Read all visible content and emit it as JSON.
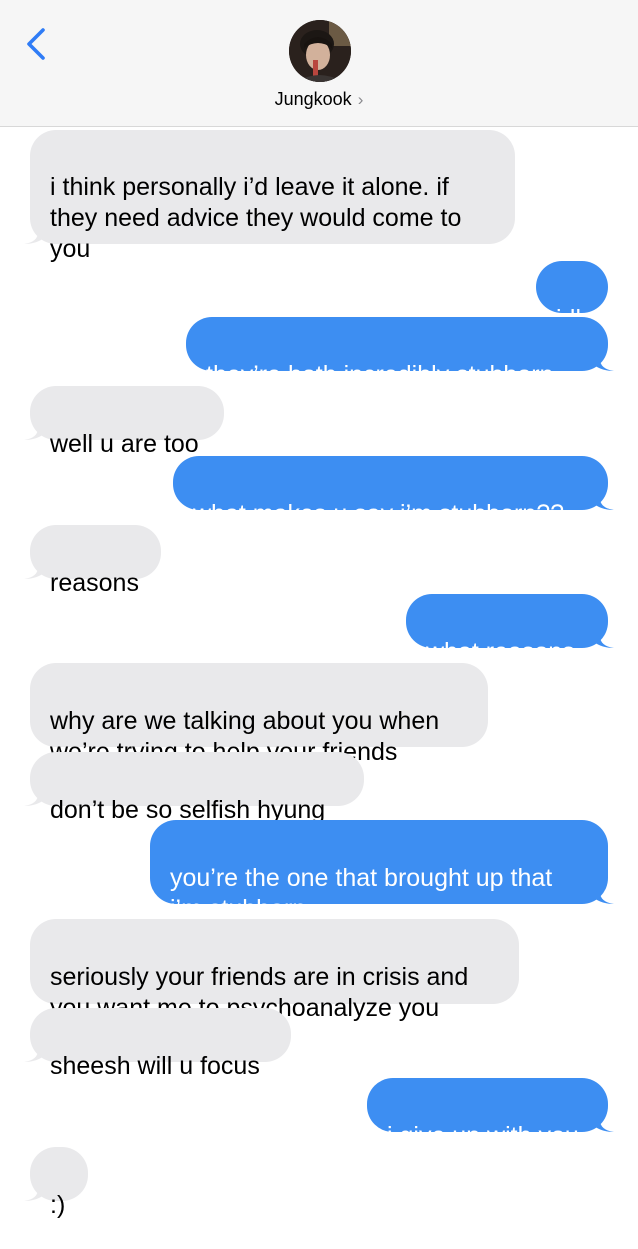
{
  "header": {
    "contact_name": "Jungkook",
    "chevron": "›",
    "icons": {
      "back": "chevron-left-icon",
      "avatar": "contact-avatar"
    },
    "colors": {
      "accent": "#3d8ef2",
      "incoming": "#e9e9eb",
      "outgoing": "#3d8ef2"
    }
  },
  "messages": [
    {
      "side": "in",
      "text": "i think personally i’d leave it alone. if\nthey need advice they would come to\nyou"
    },
    {
      "side": "out",
      "text": "idk"
    },
    {
      "side": "out",
      "text": "they’re both incredibly stubborn"
    },
    {
      "side": "in",
      "text": "well u are too"
    },
    {
      "side": "out",
      "text": "what makes u say i’m stubborn??"
    },
    {
      "side": "in",
      "text": "reasons"
    },
    {
      "side": "out",
      "text": "what reasons"
    },
    {
      "side": "in",
      "text": "why are we talking about you when\nwe’re trying to help your friends"
    },
    {
      "side": "in",
      "text": "don’t be so selfish hyung"
    },
    {
      "side": "out",
      "text": "you’re the one that brought up that\ni’m stubborn"
    },
    {
      "side": "in",
      "text": "seriously your friends are in crisis and\nyou want me to psychoanalyze you"
    },
    {
      "side": "in",
      "text": "sheesh will u focus"
    },
    {
      "side": "out",
      "text": "i give up with you"
    },
    {
      "side": "in",
      "text": ":)"
    }
  ]
}
